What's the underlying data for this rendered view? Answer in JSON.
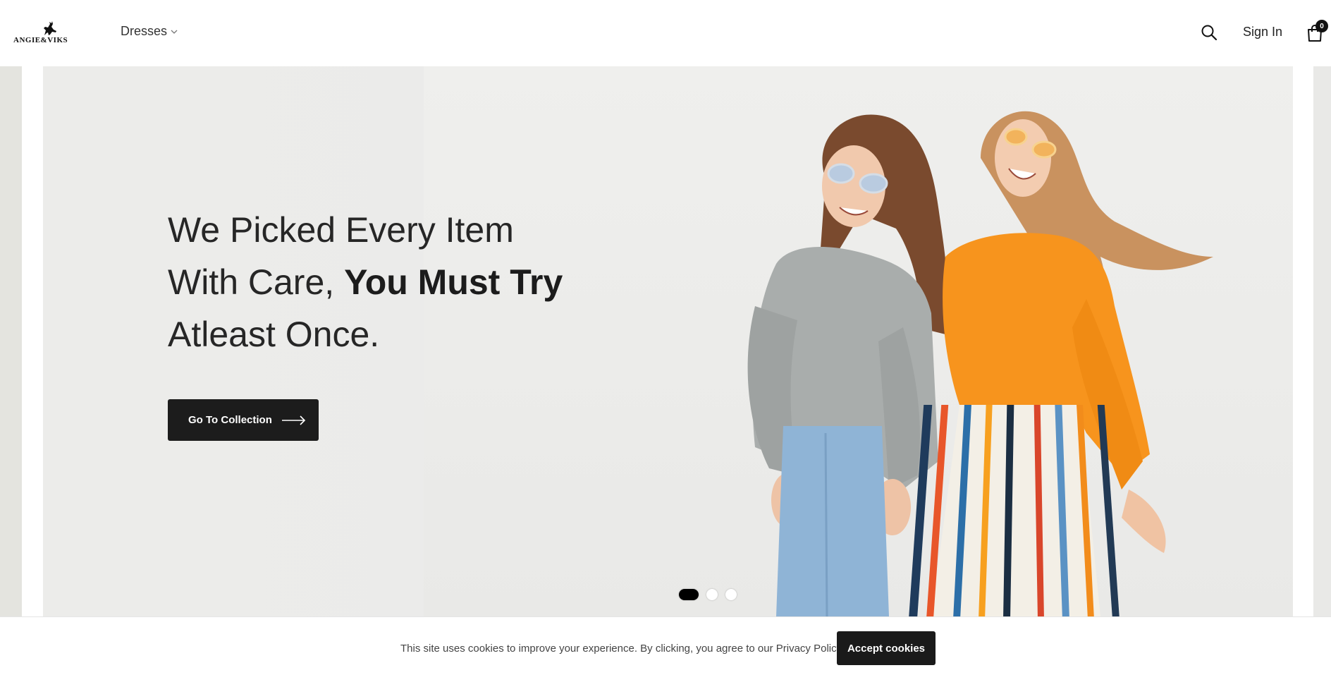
{
  "header": {
    "logo_text": "ANGIE&VIKS",
    "nav": {
      "dresses_label": "Dresses"
    },
    "signin_label": "Sign In",
    "cart_count": "0",
    "icons": {
      "search": "search-icon",
      "cart": "shopping-bag-icon",
      "chevron": "chevron-down-icon",
      "logo": "deer-logo-icon"
    }
  },
  "hero": {
    "line1": "We Picked Every Item",
    "line2_regular": "With Care, ",
    "line2_bold": "You Must Try",
    "line3": "Atleast Once.",
    "cta_label": "Go To Collection",
    "slide_count": 3,
    "active_slide": 1
  },
  "cookie": {
    "text": "This site uses cookies to improve your experience. By clicking, you agree to our Privacy Policy.",
    "accept_label": "Accept cookies"
  },
  "colors": {
    "primary": "#1c1c1c",
    "hero_bg": "#ebebea",
    "sweater_grey": "#a9adac",
    "sweater_orange": "#f7941d",
    "jeans_blue": "#8fb4d6"
  }
}
